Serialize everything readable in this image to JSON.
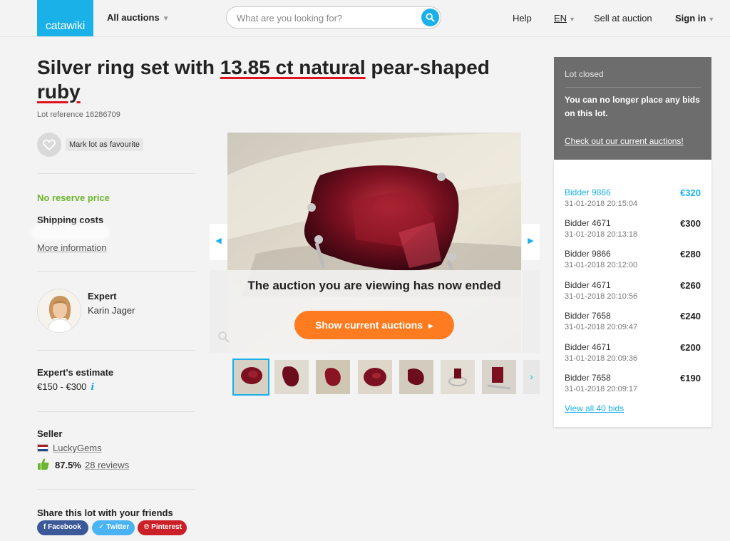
{
  "header": {
    "logo": "catawiki",
    "all_auctions": "All auctions",
    "search_placeholder": "What are you looking for?",
    "help": "Help",
    "language": "EN",
    "sell": "Sell at auction",
    "sign_in": "Sign in"
  },
  "lot": {
    "title_part1": "Silver ring set with ",
    "title_highlight1": "13.85 ct natural",
    "title_part2": " pear-shaped ",
    "title_highlight2": "ruby",
    "reference": "Lot reference 16286709",
    "favourite_label": "Mark lot as favourite",
    "no_reserve": "No reserve price",
    "shipping_label": "Shipping costs",
    "more_info": "More information"
  },
  "expert": {
    "title": "Expert",
    "name": "Karin Jager",
    "estimate_label": "Expert's estimate",
    "estimate_value": "€150 - €300"
  },
  "seller": {
    "label": "Seller",
    "name": "LuckyGems",
    "rating": "87.5%",
    "reviews": "28 reviews"
  },
  "share": {
    "label": "Share this lot with your friends",
    "facebook": "Facebook",
    "twitter": "Twitter",
    "pinterest": "Pinterest"
  },
  "gallery": {
    "ended_text": "The auction you are viewing has now ended",
    "cta": "Show current auctions",
    "thumbnail_count": 7
  },
  "status": {
    "heading": "Lot closed",
    "message": "You can no longer place any bids on this lot.",
    "link": "Check out our current auctions!"
  },
  "bids": [
    {
      "bidder": "Bidder 9866",
      "time": "31-01-2018 20:15:04",
      "amount": "€320"
    },
    {
      "bidder": "Bidder 4671",
      "time": "31-01-2018 20:13:18",
      "amount": "€300"
    },
    {
      "bidder": "Bidder 9866",
      "time": "31-01-2018 20:12:00",
      "amount": "€280"
    },
    {
      "bidder": "Bidder 4671",
      "time": "31-01-2018 20:10:56",
      "amount": "€260"
    },
    {
      "bidder": "Bidder 7658",
      "time": "31-01-2018 20:09:47",
      "amount": "€240"
    },
    {
      "bidder": "Bidder 4671",
      "time": "31-01-2018 20:09:36",
      "amount": "€200"
    },
    {
      "bidder": "Bidder 7658",
      "time": "31-01-2018 20:09:17",
      "amount": "€190"
    }
  ],
  "view_all_bids": "View all 40 bids",
  "colors": {
    "brand": "#1ab0e8",
    "cta": "#ff7b1f",
    "no_reserve": "#6cb52f",
    "title_underline": "#e0141e",
    "status_bg": "#6d6d6d"
  }
}
